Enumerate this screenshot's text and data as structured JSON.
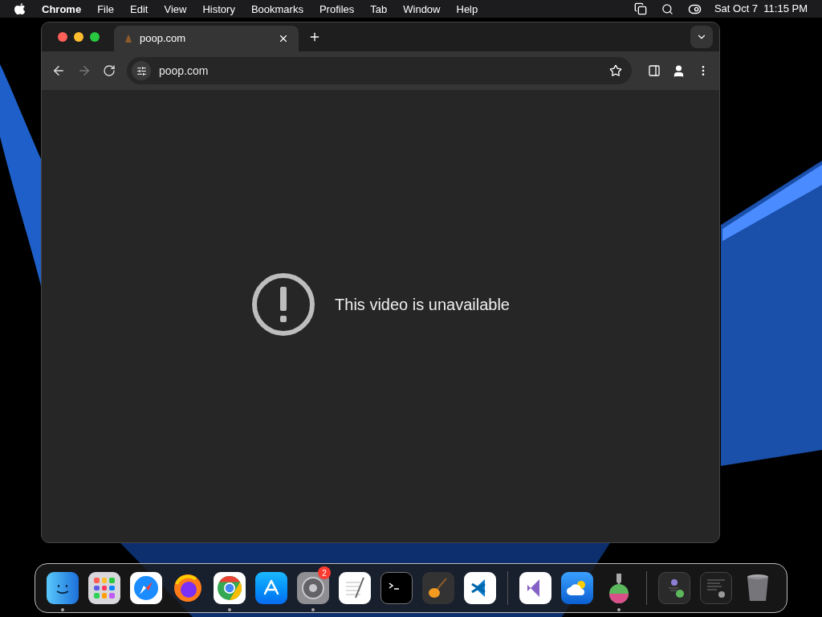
{
  "menu_bar": {
    "items": [
      {
        "label": "Chrome",
        "kind": "app"
      },
      {
        "label": "File",
        "kind": "menu"
      },
      {
        "label": "Edit",
        "kind": "menu"
      },
      {
        "label": "View",
        "kind": "menu"
      },
      {
        "label": "History",
        "kind": "menu"
      },
      {
        "label": "Bookmarks",
        "kind": "menu"
      },
      {
        "label": "Profiles",
        "kind": "menu"
      },
      {
        "label": "Tab",
        "kind": "menu"
      },
      {
        "label": "Window",
        "kind": "menu"
      },
      {
        "label": "Help",
        "kind": "menu"
      }
    ],
    "clock": "Sat Oct 7  11:15 PM"
  },
  "browser": {
    "tabs": [
      {
        "title": "poop.com",
        "selected": true
      }
    ],
    "toolbar": {
      "back_disabled": false,
      "forward_disabled": true,
      "address": "poop.com"
    },
    "content": {
      "message": "This video is unavailable"
    }
  },
  "dock": {
    "groups": [
      [
        {
          "running": true
        },
        {
          "running": false
        },
        {
          "running": false
        },
        {
          "running": false
        },
        {
          "running": true
        },
        {
          "running": false
        },
        {
          "running": true,
          "badge": "2"
        },
        {
          "running": false
        },
        {
          "running": false
        },
        {
          "running": false
        },
        {
          "running": false
        }
      ],
      [
        {
          "running": false
        },
        {
          "running": false
        },
        {
          "running": true
        }
      ],
      [
        {
          "running": false
        },
        {
          "running": false
        },
        {
          "running": false
        }
      ]
    ]
  }
}
